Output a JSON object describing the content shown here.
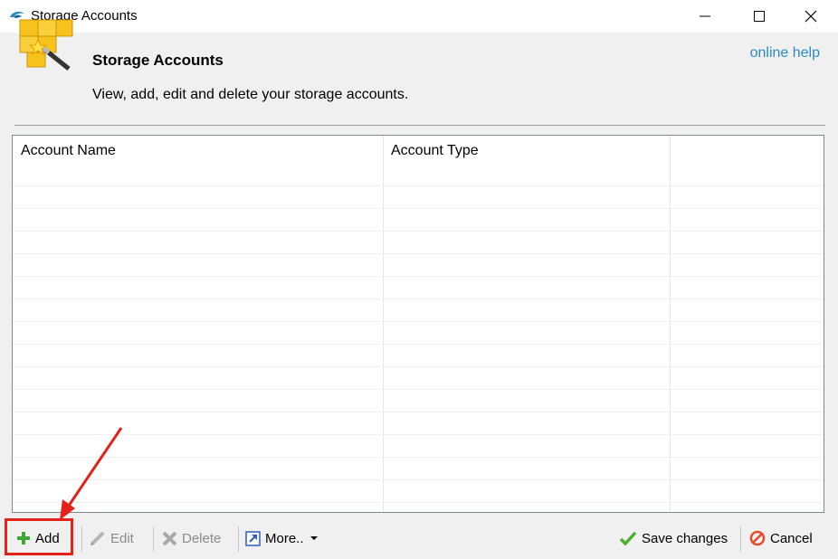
{
  "window": {
    "title": "Storage Accounts",
    "controls": [
      "minimize",
      "maximize",
      "close"
    ]
  },
  "header": {
    "title": "Storage Accounts",
    "description": "View, add, edit and delete your storage accounts.",
    "help_link": "online help",
    "icon": "storage-boxes-wand-icon"
  },
  "grid": {
    "columns": [
      "Account Name",
      "Account Type",
      ""
    ],
    "rows": []
  },
  "toolbar": {
    "add_label": "Add",
    "edit_label": "Edit",
    "delete_label": "Delete",
    "more_label": "More..",
    "save_label": "Save changes",
    "cancel_label": "Cancel"
  },
  "colors": {
    "accent_link": "#2b8ac6",
    "annotation_red": "#e32219",
    "add_green": "#3aa935",
    "save_green": "#4caf32",
    "cancel_red": "#e84a2a"
  }
}
